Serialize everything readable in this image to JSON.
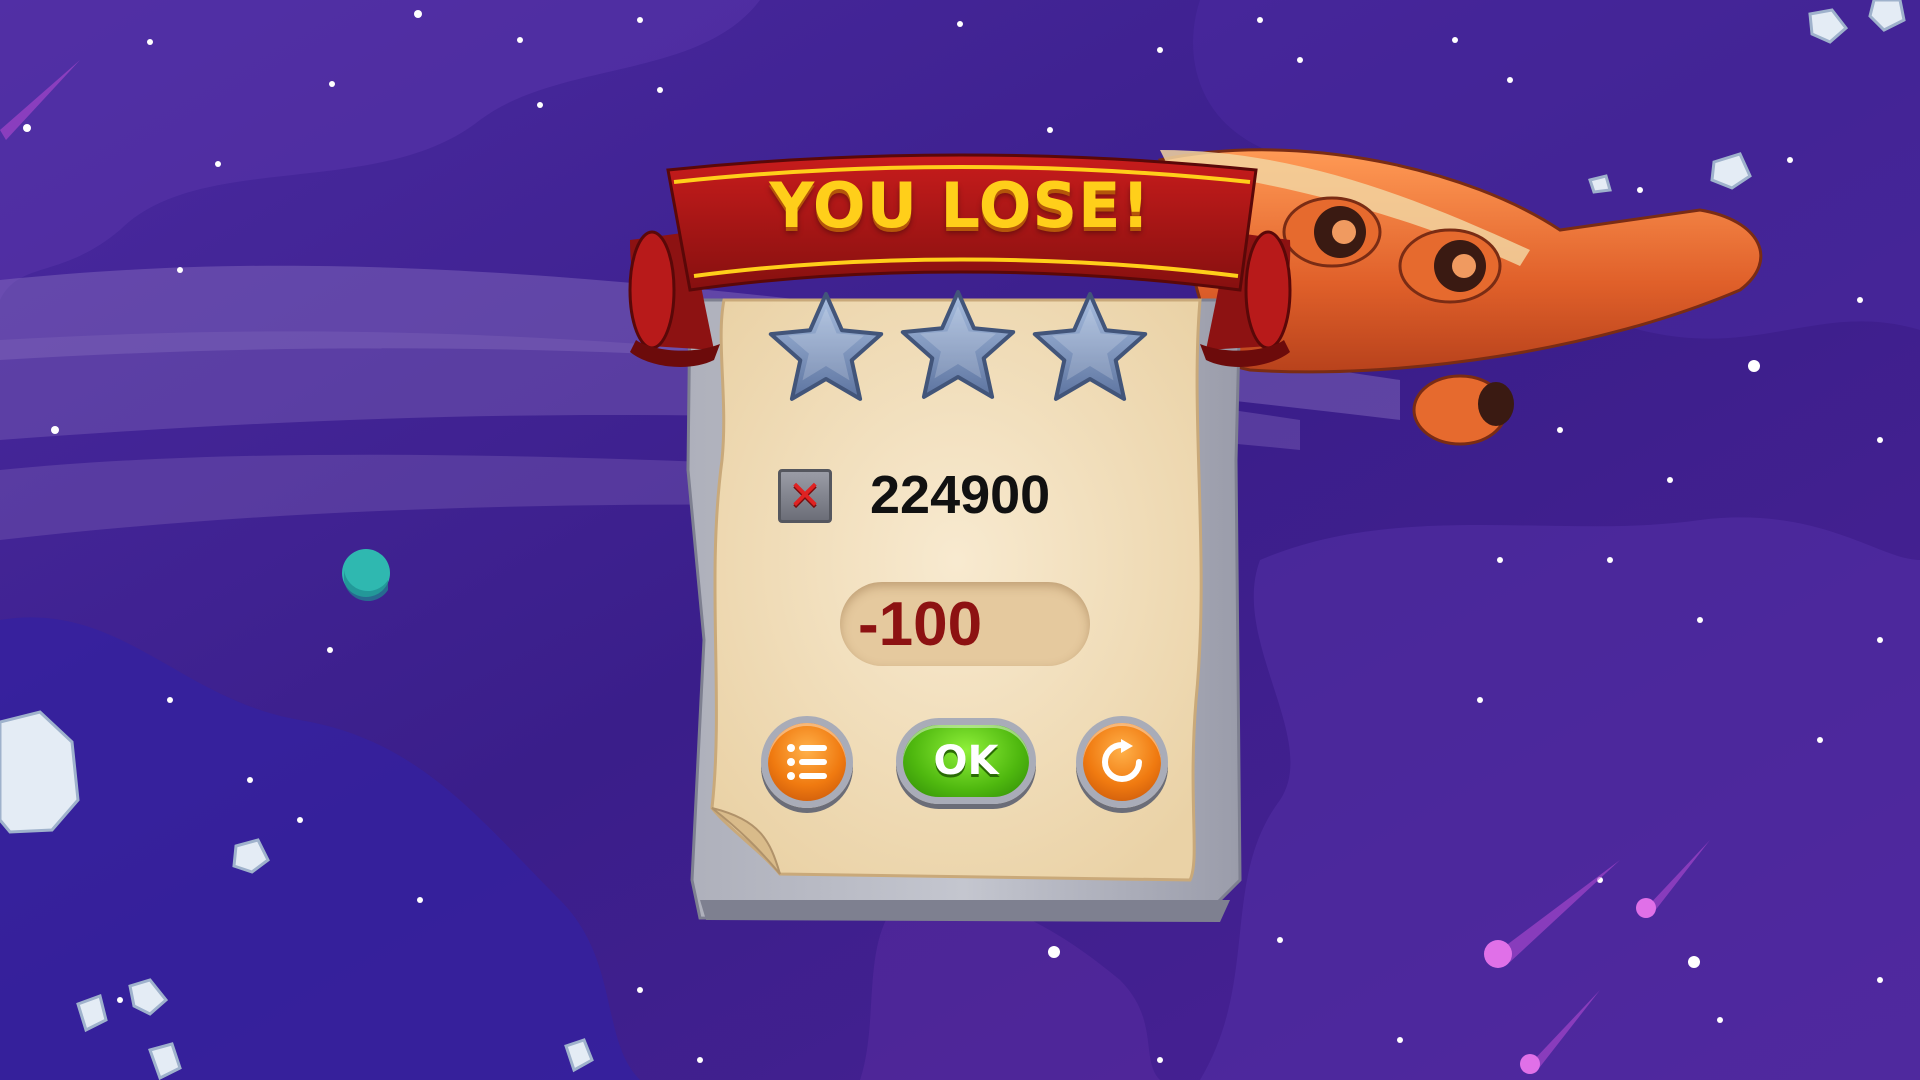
{
  "title": "YOU LOSE!",
  "rating": {
    "stars_earned": 0,
    "stars_total": 3
  },
  "score": {
    "icon": "red-x-icon",
    "value": "224900"
  },
  "coins": {
    "value": "-100",
    "icon": "gold-coin-icon"
  },
  "buttons": {
    "menu_icon": "list-menu-icon",
    "ok_label": "OK",
    "retry_icon": "restart-icon"
  },
  "colors": {
    "background": "#3d1f8c",
    "banner": "#a81418",
    "title_text": "#ffcf1a",
    "parchment": "#f4e2c0",
    "coin_text": "#8d1212",
    "ok_button": "#4fb80f",
    "side_buttons": "#f07a10",
    "star_empty": "#7d93b8"
  }
}
